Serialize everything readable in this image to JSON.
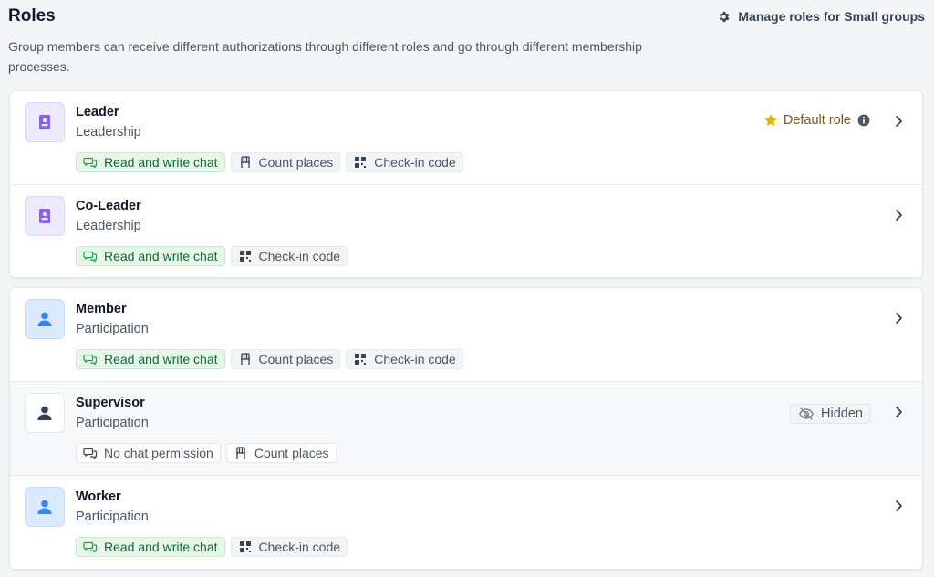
{
  "header": {
    "title": "Roles",
    "manage_label": "Manage roles for Small groups",
    "description": "Group members can receive different authorizations through different roles and go through different membership processes."
  },
  "badges": {
    "default_role": "Default role",
    "hidden": "Hidden"
  },
  "groups": [
    {
      "roles": [
        {
          "name": "Leader",
          "category": "Leadership",
          "tags": [
            "Read and write chat",
            "Count places",
            "Check-in code"
          ]
        },
        {
          "name": "Co-Leader",
          "category": "Leadership",
          "tags": [
            "Read and write chat",
            "Check-in code"
          ]
        }
      ]
    },
    {
      "roles": [
        {
          "name": "Member",
          "category": "Participation",
          "tags": [
            "Read and write chat",
            "Count places",
            "Check-in code"
          ]
        },
        {
          "name": "Supervisor",
          "category": "Participation",
          "tags": [
            "No chat permission",
            "Count places"
          ]
        },
        {
          "name": "Worker",
          "category": "Participation",
          "tags": [
            "Read and write chat",
            "Check-in code"
          ]
        }
      ]
    }
  ],
  "colors": {
    "leadership_icon": "#8b5cf6",
    "participation_icon": "#3b82f6",
    "hidden_role_icon": "#374151",
    "chat_tag_bg": "#e6f7ea",
    "default_star": "#eab308"
  }
}
